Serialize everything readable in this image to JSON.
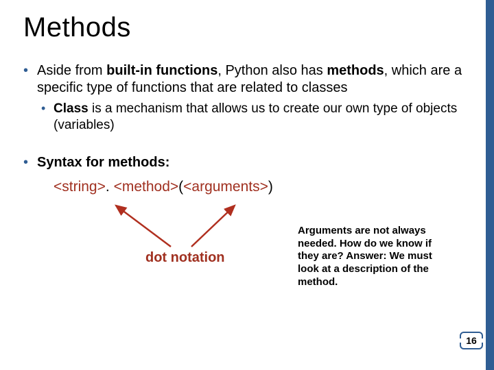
{
  "title": "Methods",
  "bullets": {
    "b1_pre": "Aside from ",
    "b1_bold1": "built-in functions",
    "b1_mid": ", Python also has ",
    "b1_bold2": "methods",
    "b1_post": ", which are a specific type of functions that are related to classes",
    "b1a_bold": "Class",
    "b1a_rest": " is a mechanism that allows us to create our own type of objects (variables)",
    "b2": "Syntax for methods:"
  },
  "syntax": {
    "string": "<string>",
    "dot": ". ",
    "method": "<method>",
    "lparen": "(",
    "args": "<arguments>",
    "rparen": ")"
  },
  "annotations": {
    "dot_notation": "dot notation",
    "args_note": "Arguments are not always needed. How do we know if they are? Answer: We must look at a description of the method."
  },
  "page_number": "16"
}
